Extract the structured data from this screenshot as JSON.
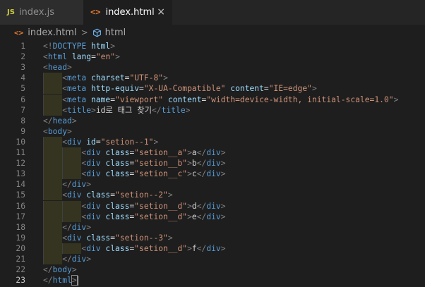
{
  "tabs": [
    {
      "icon": "JS",
      "label": "index.js",
      "active": false
    },
    {
      "icon": "<>",
      "label": "index.html",
      "active": true,
      "close": "×"
    }
  ],
  "breadcrumb": {
    "file_icon": "<>",
    "file": "index.html",
    "separator": ">",
    "symbol": "html"
  },
  "colors": {
    "tag": "#569cd6",
    "attribute": "#9cdcfe",
    "string": "#ce9178",
    "bracket": "#808080",
    "text": "#d4d4d4",
    "line_number": "#858585"
  },
  "current_line": 23,
  "lines": [
    {
      "n": "1",
      "indent": 0,
      "tokens": [
        [
          "b",
          "<!"
        ],
        [
          "g",
          "DOCTYPE"
        ],
        [
          "t",
          " "
        ],
        [
          "a",
          "html"
        ],
        [
          "b",
          ">"
        ]
      ]
    },
    {
      "n": "2",
      "indent": 0,
      "tokens": [
        [
          "b",
          "<"
        ],
        [
          "g",
          "html"
        ],
        [
          "t",
          " "
        ],
        [
          "a",
          "lang"
        ],
        [
          "t",
          "="
        ],
        [
          "s",
          "\"en\""
        ],
        [
          "b",
          ">"
        ]
      ]
    },
    {
      "n": "3",
      "indent": 0,
      "tokens": [
        [
          "b",
          "<"
        ],
        [
          "g",
          "head"
        ],
        [
          "b",
          ">"
        ]
      ]
    },
    {
      "n": "4",
      "indent": 1,
      "tokens": [
        [
          "b",
          "<"
        ],
        [
          "g",
          "meta"
        ],
        [
          "t",
          " "
        ],
        [
          "a",
          "charset"
        ],
        [
          "t",
          "="
        ],
        [
          "s",
          "\"UTF-8\""
        ],
        [
          "b",
          ">"
        ]
      ]
    },
    {
      "n": "5",
      "indent": 1,
      "tokens": [
        [
          "b",
          "<"
        ],
        [
          "g",
          "meta"
        ],
        [
          "t",
          " "
        ],
        [
          "a",
          "http-equiv"
        ],
        [
          "t",
          "="
        ],
        [
          "s",
          "\"X-UA-Compatible\""
        ],
        [
          "t",
          " "
        ],
        [
          "a",
          "content"
        ],
        [
          "t",
          "="
        ],
        [
          "s",
          "\"IE=edge\""
        ],
        [
          "b",
          ">"
        ]
      ]
    },
    {
      "n": "6",
      "indent": 1,
      "tokens": [
        [
          "b",
          "<"
        ],
        [
          "g",
          "meta"
        ],
        [
          "t",
          " "
        ],
        [
          "a",
          "name"
        ],
        [
          "t",
          "="
        ],
        [
          "s",
          "\"viewport\""
        ],
        [
          "t",
          " "
        ],
        [
          "a",
          "content"
        ],
        [
          "t",
          "="
        ],
        [
          "s",
          "\"width=device-width, initial-scale=1.0\""
        ],
        [
          "b",
          ">"
        ]
      ]
    },
    {
      "n": "7",
      "indent": 1,
      "tokens": [
        [
          "b",
          "<"
        ],
        [
          "g",
          "title"
        ],
        [
          "b",
          ">"
        ],
        [
          "t",
          "id로 태그 찾기"
        ],
        [
          "b",
          "</"
        ],
        [
          "g",
          "title"
        ],
        [
          "b",
          ">"
        ]
      ]
    },
    {
      "n": "8",
      "indent": 0,
      "tokens": [
        [
          "b",
          "</"
        ],
        [
          "g",
          "head"
        ],
        [
          "b",
          ">"
        ]
      ]
    },
    {
      "n": "9",
      "indent": 0,
      "tokens": [
        [
          "b",
          "<"
        ],
        [
          "g",
          "body"
        ],
        [
          "b",
          ">"
        ]
      ]
    },
    {
      "n": "10",
      "indent": 1,
      "tokens": [
        [
          "b",
          "<"
        ],
        [
          "g",
          "div"
        ],
        [
          "t",
          " "
        ],
        [
          "a",
          "id"
        ],
        [
          "t",
          "="
        ],
        [
          "s",
          "\"setion--1\""
        ],
        [
          "b",
          ">"
        ]
      ]
    },
    {
      "n": "11",
      "indent": 2,
      "tokens": [
        [
          "b",
          "<"
        ],
        [
          "g",
          "div"
        ],
        [
          "t",
          " "
        ],
        [
          "a",
          "class"
        ],
        [
          "t",
          "="
        ],
        [
          "s",
          "\"setion__a\""
        ],
        [
          "b",
          ">"
        ],
        [
          "t",
          "a"
        ],
        [
          "b",
          "</"
        ],
        [
          "g",
          "div"
        ],
        [
          "b",
          ">"
        ]
      ]
    },
    {
      "n": "12",
      "indent": 2,
      "tokens": [
        [
          "b",
          "<"
        ],
        [
          "g",
          "div"
        ],
        [
          "t",
          " "
        ],
        [
          "a",
          "class"
        ],
        [
          "t",
          "="
        ],
        [
          "s",
          "\"setion__b\""
        ],
        [
          "b",
          ">"
        ],
        [
          "t",
          "b"
        ],
        [
          "b",
          "</"
        ],
        [
          "g",
          "div"
        ],
        [
          "b",
          ">"
        ]
      ]
    },
    {
      "n": "13",
      "indent": 2,
      "tokens": [
        [
          "b",
          "<"
        ],
        [
          "g",
          "div"
        ],
        [
          "t",
          " "
        ],
        [
          "a",
          "class"
        ],
        [
          "t",
          "="
        ],
        [
          "s",
          "\"setion__c\""
        ],
        [
          "b",
          ">"
        ],
        [
          "t",
          "c"
        ],
        [
          "b",
          "</"
        ],
        [
          "g",
          "div"
        ],
        [
          "b",
          ">"
        ]
      ]
    },
    {
      "n": "14",
      "indent": 1,
      "tokens": [
        [
          "b",
          "</"
        ],
        [
          "g",
          "div"
        ],
        [
          "b",
          ">"
        ]
      ]
    },
    {
      "n": "15",
      "indent": 1,
      "tokens": [
        [
          "b",
          "<"
        ],
        [
          "g",
          "div"
        ],
        [
          "t",
          " "
        ],
        [
          "a",
          "class"
        ],
        [
          "t",
          "="
        ],
        [
          "s",
          "\"setion--2\""
        ],
        [
          "b",
          ">"
        ]
      ]
    },
    {
      "n": "16",
      "indent": 2,
      "tokens": [
        [
          "b",
          "<"
        ],
        [
          "g",
          "div"
        ],
        [
          "t",
          " "
        ],
        [
          "a",
          "class"
        ],
        [
          "t",
          "="
        ],
        [
          "s",
          "\"setion__d\""
        ],
        [
          "b",
          ">"
        ],
        [
          "t",
          "d"
        ],
        [
          "b",
          "</"
        ],
        [
          "g",
          "div"
        ],
        [
          "b",
          ">"
        ]
      ]
    },
    {
      "n": "17",
      "indent": 2,
      "tokens": [
        [
          "b",
          "<"
        ],
        [
          "g",
          "div"
        ],
        [
          "t",
          " "
        ],
        [
          "a",
          "class"
        ],
        [
          "t",
          "="
        ],
        [
          "s",
          "\"setion__d\""
        ],
        [
          "b",
          ">"
        ],
        [
          "t",
          "e"
        ],
        [
          "b",
          "</"
        ],
        [
          "g",
          "div"
        ],
        [
          "b",
          ">"
        ]
      ]
    },
    {
      "n": "18",
      "indent": 1,
      "tokens": [
        [
          "b",
          "</"
        ],
        [
          "g",
          "div"
        ],
        [
          "b",
          ">"
        ]
      ]
    },
    {
      "n": "19",
      "indent": 1,
      "tokens": [
        [
          "b",
          "<"
        ],
        [
          "g",
          "div"
        ],
        [
          "t",
          " "
        ],
        [
          "a",
          "class"
        ],
        [
          "t",
          "="
        ],
        [
          "s",
          "\"setion--3\""
        ],
        [
          "b",
          ">"
        ]
      ]
    },
    {
      "n": "20",
      "indent": 2,
      "tokens": [
        [
          "b",
          "<"
        ],
        [
          "g",
          "div"
        ],
        [
          "t",
          " "
        ],
        [
          "a",
          "class"
        ],
        [
          "t",
          "="
        ],
        [
          "s",
          "\"setion__d\""
        ],
        [
          "b",
          ">"
        ],
        [
          "t",
          "f"
        ],
        [
          "b",
          "</"
        ],
        [
          "g",
          "div"
        ],
        [
          "b",
          ">"
        ]
      ]
    },
    {
      "n": "21",
      "indent": 1,
      "tokens": [
        [
          "b",
          "</"
        ],
        [
          "g",
          "div"
        ],
        [
          "b",
          ">"
        ]
      ]
    },
    {
      "n": "22",
      "indent": 0,
      "tokens": [
        [
          "b",
          "</"
        ],
        [
          "g",
          "body"
        ],
        [
          "b",
          ">"
        ]
      ]
    },
    {
      "n": "23",
      "indent": 0,
      "tokens": [
        [
          "b",
          "</"
        ],
        [
          "g",
          "html"
        ],
        [
          "b",
          ">"
        ]
      ]
    }
  ]
}
